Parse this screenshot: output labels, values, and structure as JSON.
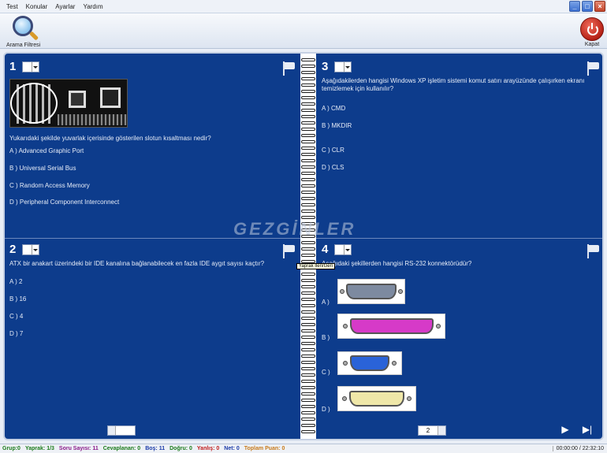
{
  "menu": [
    "Test",
    "Konular",
    "Ayarlar",
    "Yardım"
  ],
  "toolbar": {
    "search_label": "Arama Filtresi",
    "exit_label": "Kapat"
  },
  "watermark": "GEZGİNLER",
  "tooltip": "Yaprak İleri/Geri",
  "questions": [
    {
      "number": "1",
      "text": "Yukarıdaki şekilde yuvarlak içerisinde gösterilen slotun kısaltması nedir?",
      "options": [
        "A ) Advanced Graphic Port",
        "B ) Universal Serial Bus",
        "C ) Random Access Memory",
        "D ) Peripheral Component Interconnect"
      ]
    },
    {
      "number": "3",
      "text": "Aşağıdakilerden hangisi Windows XP işletim sistemi komut satırı arayüzünde çalışırken ekranı temizlemek için kullanılır?",
      "options": [
        "A ) CMD",
        "B ) MKDIR",
        "C ) CLR",
        "D ) CLS"
      ]
    },
    {
      "number": "2",
      "text": "ATX bir anakart üzerindeki bir IDE kanalına bağlanabilecek en fazla IDE aygıt sayısı kaçtır?",
      "options": [
        "A ) 2",
        "B ) 16",
        "C ) 4",
        "D ) 7"
      ]
    },
    {
      "number": "4",
      "text": "Aşağıdaki şekillerden hangisi RS-232 konnektörüdür?",
      "options": [
        "A )",
        "B )",
        "C )",
        "D )"
      ]
    }
  ],
  "pager": {
    "left_value": "",
    "right_value": "2"
  },
  "status": [
    {
      "text": "Grup:0",
      "color": "#1a7a1a"
    },
    {
      "text": "Yaprak: 1/3",
      "color": "#1a7a1a"
    },
    {
      "text": "Soru Sayısı: 11",
      "color": "#8a1a8a"
    },
    {
      "text": "Cevaplanan: 0",
      "color": "#1a7a1a"
    },
    {
      "text": "Boş: 11",
      "color": "#1a3aa8"
    },
    {
      "text": "Doğru: 0",
      "color": "#1a7a1a"
    },
    {
      "text": "Yanlış: 0",
      "color": "#c01a1a"
    },
    {
      "text": "Net: 0",
      "color": "#1a3aa8"
    },
    {
      "text": "Toplam Puan: 0",
      "color": "#c87a1a"
    }
  ],
  "clock": "00:00:00 / 22:32:10",
  "colors": {
    "page_bg": "#0d3c8c",
    "page_text": "#e6ecf7"
  }
}
